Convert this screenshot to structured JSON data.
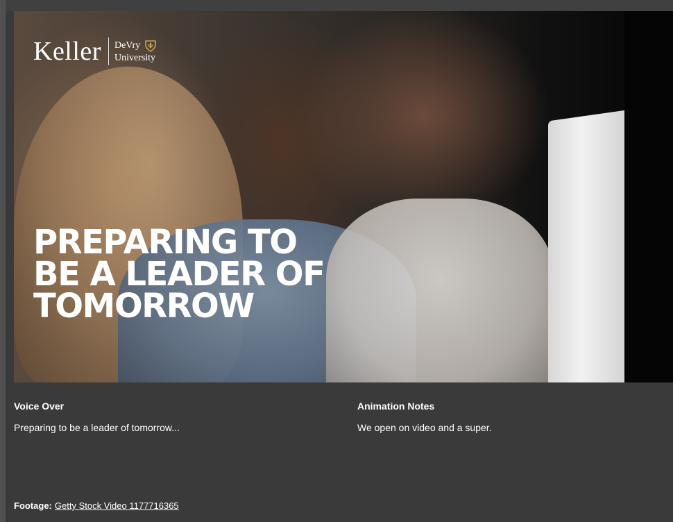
{
  "hero": {
    "logo": {
      "primary": "Keller",
      "secondary_line1": "DeVry",
      "secondary_line2": "University",
      "icon": "shield-icon"
    },
    "headline_lines": [
      "PREPARING TO",
      "BE A LEADER OF",
      "TOMORROW"
    ]
  },
  "notes": {
    "voice_over": {
      "label": "Voice Over",
      "text": "Preparing to be a leader of tomorrow..."
    },
    "animation_notes": {
      "label": "Animation Notes",
      "text": "We open on video and a super."
    },
    "footage": {
      "label": "Footage:",
      "link_text": "Getty Stock Video 1177716365"
    }
  },
  "colors": {
    "background": "#3a3a3a",
    "text": "#ffffff",
    "logo_accent": "#c9a44a"
  }
}
